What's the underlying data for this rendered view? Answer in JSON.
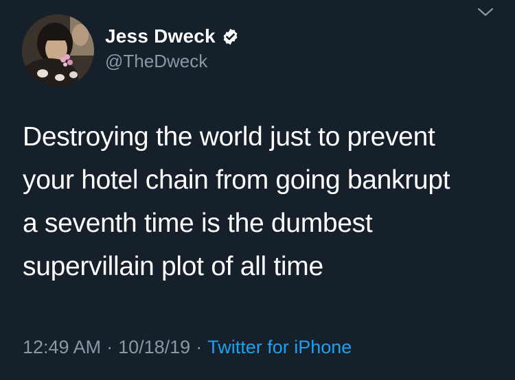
{
  "author": {
    "display_name": "Jess Dweck",
    "handle": "@TheDweck",
    "verified": true,
    "avatar_icon": "profile-photo"
  },
  "menu": {
    "icon": "chevron-down-icon"
  },
  "tweet": {
    "lines": [
      "Destroying the world just to prevent",
      "your hotel chain from going bankrupt",
      "a seventh time is the dumbest",
      "supervillain plot of all time"
    ]
  },
  "meta": {
    "time": "12:49 AM",
    "separator": "·",
    "date": "10/18/19",
    "source": "Twitter for iPhone"
  },
  "colors": {
    "background": "#15202b",
    "secondary_text": "#8899a6",
    "link": "#1da1f2",
    "primary_text": "#ffffff"
  }
}
